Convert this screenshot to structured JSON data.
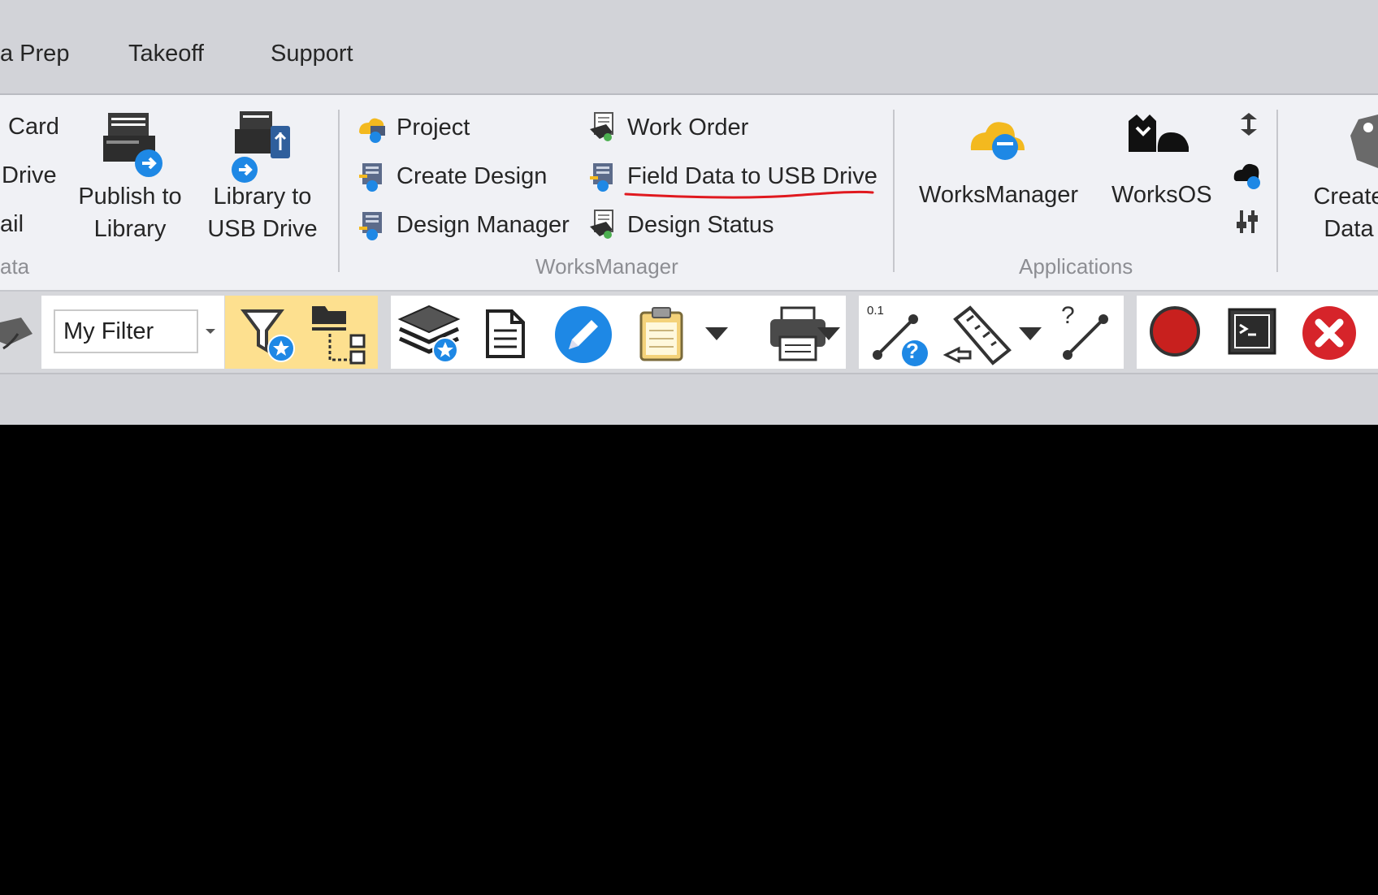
{
  "menu": {
    "data_prep": "a Prep",
    "takeoff": "Takeoff",
    "support": "Support"
  },
  "ribbon": {
    "left_partial": {
      "card": "Card",
      "drive": "Drive",
      "ail": "ail",
      "group": "ata"
    },
    "publish_to_library": {
      "line1": "Publish to",
      "line2": "Library"
    },
    "library_to_usb": {
      "line1": "Library to",
      "line2": "USB Drive"
    },
    "worksmanager_group": {
      "label": "WorksManager",
      "project": "Project",
      "create_design": "Create Design",
      "design_manager": "Design Manager",
      "work_order": "Work Order",
      "field_data_usb": "Field Data to USB Drive",
      "design_status": "Design Status"
    },
    "applications_group": {
      "label": "Applications",
      "worksmanager": "WorksManager",
      "worksos": "WorksOS"
    },
    "right_partial": {
      "line1": "Create",
      "line2": "Data"
    }
  },
  "toolbar": {
    "filter_value": "My Filter",
    "measure_label": "0.1",
    "query_label": "?"
  },
  "colors": {
    "accent_yellow": "#fde08f",
    "annotation_red": "#e0191f",
    "record_red": "#c8201e",
    "blue_icon": "#1e88e5"
  }
}
